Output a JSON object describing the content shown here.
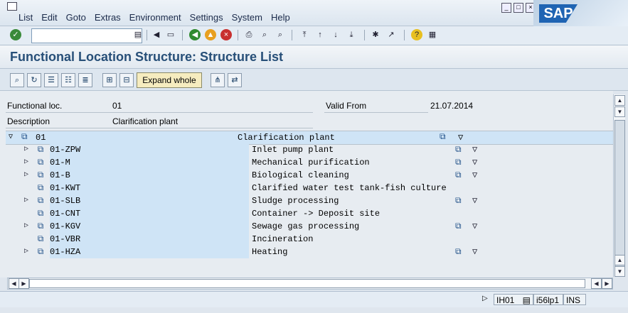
{
  "menu": [
    "List",
    "Edit",
    "Goto",
    "Extras",
    "Environment",
    "Settings",
    "System",
    "Help"
  ],
  "sap_logo": "SAP",
  "page_title": "Functional Location Structure: Structure List",
  "toolbar2": {
    "expand_label": "Expand whole"
  },
  "header": {
    "func_loc_label": "Functional loc.",
    "func_loc_value": "01",
    "valid_from_label": "Valid From",
    "valid_from_value": "21.07.2014",
    "description_label": "Description",
    "description_value": "Clarification plant"
  },
  "root": {
    "id": "01",
    "description": "Clarification plant"
  },
  "rows": [
    {
      "id": "01-ZPW",
      "description": "Inlet pump plant",
      "expandable": true
    },
    {
      "id": "01-M",
      "description": "Mechanical purification",
      "expandable": true
    },
    {
      "id": "01-B",
      "description": "Biological cleaning",
      "expandable": true
    },
    {
      "id": "01-KWT",
      "description": "Clarified water test tank-fish culture",
      "expandable": false
    },
    {
      "id": "01-SLB",
      "description": "Sludge processing",
      "expandable": true
    },
    {
      "id": "01-CNT",
      "description": "Container -> Deposit site",
      "expandable": false
    },
    {
      "id": "01-KGV",
      "description": "Sewage gas processing",
      "expandable": true
    },
    {
      "id": "01-VBR",
      "description": "Incineration",
      "expandable": false
    },
    {
      "id": "01-HZA",
      "description": "Heating",
      "expandable": true
    }
  ],
  "status": {
    "tcode": "IH01",
    "server": "i56lp1",
    "mode": "INS"
  }
}
